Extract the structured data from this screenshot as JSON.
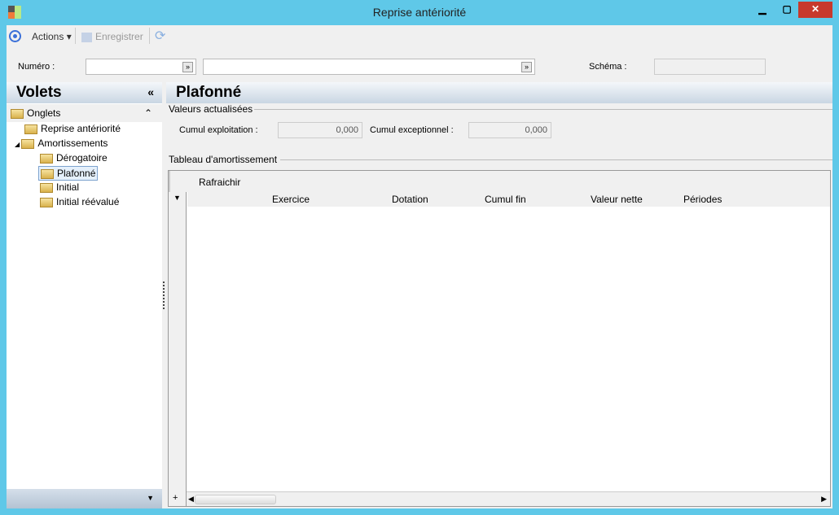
{
  "window": {
    "title": "Reprise antériorité",
    "minimize": "▁",
    "maximize": "▢",
    "close": "✕"
  },
  "toolbar": {
    "actions": "Actions",
    "save": "Enregistrer"
  },
  "header": {
    "numero_label": "Numéro :",
    "numero_value": "",
    "desc_value": "",
    "schema_label": "Schéma :",
    "schema_value": ""
  },
  "sidebar": {
    "title": "Volets",
    "collapse": "«",
    "section": "Onglets",
    "section_toggle": "⌃",
    "items": [
      {
        "label": "Reprise antériorité"
      },
      {
        "label": "Amortissements"
      },
      {
        "label": "Dérogatoire"
      },
      {
        "label": "Plafonné",
        "selected": true
      },
      {
        "label": "Initial"
      },
      {
        "label": "Initial réévalué"
      }
    ],
    "footer_arrow": "▼"
  },
  "main": {
    "title": "Plafonné",
    "valeurs": {
      "title": "Valeurs actualisées",
      "cumul_expl_label": "Cumul exploitation :",
      "cumul_expl": "0,000",
      "cumul_exc_label": "Cumul exceptionnel :",
      "cumul_exc": "0,000"
    },
    "tableau": {
      "title": "Tableau d'amortissement",
      "refresh": "Rafraichir",
      "columns": [
        "Exercice",
        "Dotation",
        "Cumul fin",
        "Valeur nette",
        "Périodes"
      ],
      "add": "+"
    }
  }
}
